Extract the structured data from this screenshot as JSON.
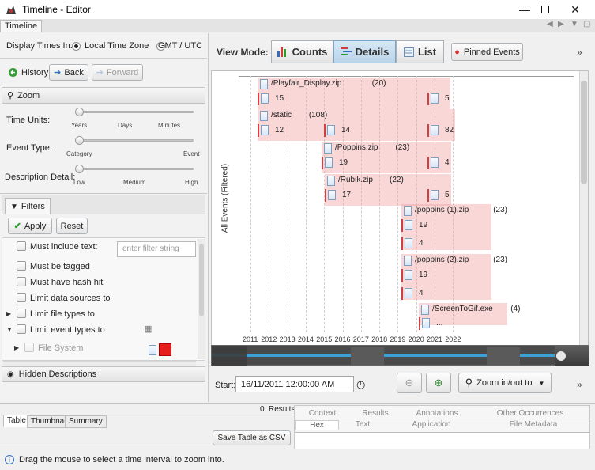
{
  "window": {
    "title": "Timeline - Editor",
    "tab": "Timeline"
  },
  "left": {
    "display_times_label": "Display Times In:",
    "tz_local": "Local Time Zone",
    "tz_gmt": "GMT / UTC",
    "history": "History",
    "back": "Back",
    "forward": "Forward",
    "zoom_header": "Zoom",
    "time_units": {
      "label": "Time Units:",
      "ticks": [
        "Years",
        "Days",
        "Minutes"
      ]
    },
    "event_type": {
      "label": "Event Type:",
      "ticks": [
        "Category",
        "Event"
      ]
    },
    "description_detail": {
      "label": "Description Detail:",
      "ticks": [
        "Low",
        "Medium",
        "High"
      ]
    },
    "filters_header": "Filters",
    "apply": "Apply",
    "reset": "Reset",
    "filter_placeholder": "enter filter string",
    "filters": [
      "Must include text:",
      "Must be tagged",
      "Must have hash hit",
      "Limit data sources to",
      "Limit file types to",
      "Limit event types to"
    ],
    "file_system": "File System",
    "hidden_descriptions": "Hidden Descriptions"
  },
  "right": {
    "view_mode_label": "View Mode:",
    "modes": [
      "Counts",
      "Details",
      "List"
    ],
    "selected_mode": "Details",
    "pinned_events": "Pinned Events",
    "y_axis_label": "All Events (Filtered)",
    "years": [
      "2011",
      "2012",
      "2013",
      "2014",
      "2015",
      "2016",
      "2017",
      "2018",
      "2019",
      "2020",
      "2021",
      "2022"
    ],
    "events": [
      {
        "name": "/Playfair_Display.zip",
        "count": "(20)",
        "subcounts": [
          "15",
          "5"
        ]
      },
      {
        "name": "/static",
        "count": "(108)",
        "subcounts": [
          "12",
          "14",
          "82"
        ]
      },
      {
        "name": "/Poppins.zip",
        "count": "(23)",
        "subcounts": [
          "19",
          "4"
        ]
      },
      {
        "name": "/Rubik.zip",
        "count": "(22)",
        "subcounts": [
          "17",
          "5"
        ]
      },
      {
        "name": "/poppins (1).zip",
        "count": "(23)",
        "subcounts": [
          "19",
          "4"
        ]
      },
      {
        "name": "/poppins (2).zip",
        "count": "(23)",
        "subcounts": [
          "19",
          "4"
        ]
      },
      {
        "name": "/ScreenToGif.exe",
        "count": "(4)",
        "subcounts": [
          "..."
        ]
      }
    ],
    "start_label": "Start:",
    "start_value": "16/11/2011 12:00:00 AM",
    "zoom_inout": "Zoom in/out to"
  },
  "bottom": {
    "tabs": [
      "Table",
      "Thumbnail",
      "Summary"
    ],
    "results_count": "0",
    "results_label": "Results",
    "save_csv": "Save Table as CSV",
    "content_tabs_row1": [
      "Context",
      "Results",
      "Annotations",
      "Other Occurrences"
    ],
    "content_tabs_row2": [
      "Hex",
      "Text",
      "Application",
      "File Metadata"
    ]
  },
  "status": "Drag the mouse to select a time interval to zoom into."
}
